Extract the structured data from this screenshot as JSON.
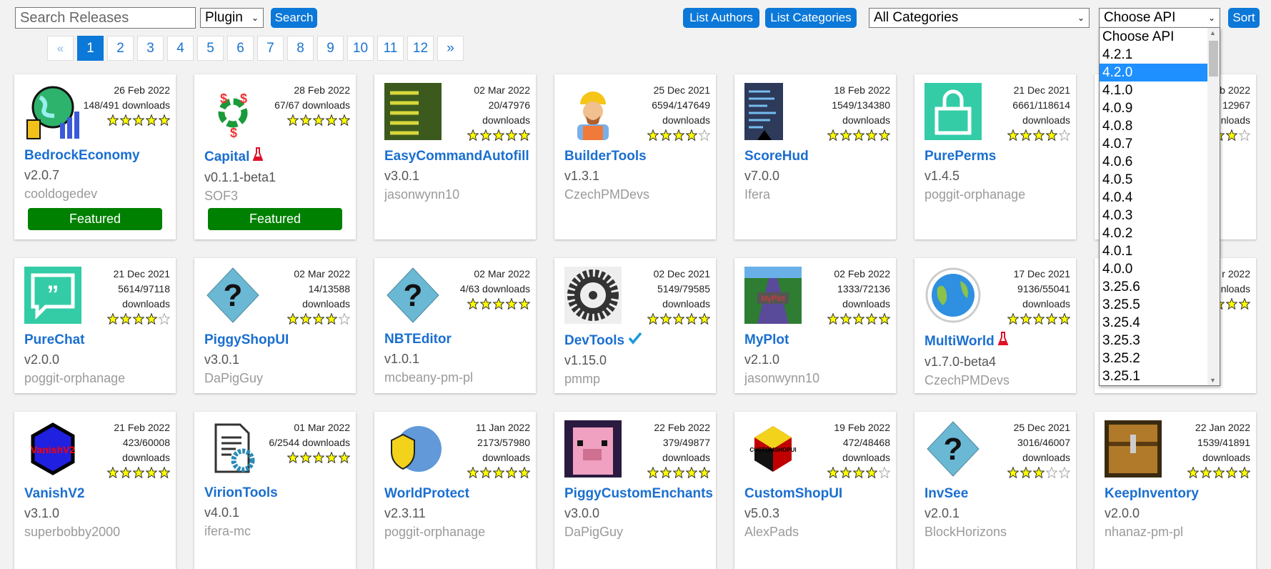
{
  "toolbar": {
    "search_placeholder": "Search Releases",
    "type_select": "Plugin",
    "search_label": "Search",
    "list_authors_label": "List Authors",
    "list_categories_label": "List Categories",
    "category_select": "All Categories",
    "api_select": "Choose API",
    "sort_label": "Sort"
  },
  "pagination": {
    "prev": "«",
    "next": "»",
    "pages": [
      "1",
      "2",
      "3",
      "4",
      "5",
      "6",
      "7",
      "8",
      "9",
      "10",
      "11",
      "12"
    ],
    "current": "1"
  },
  "api_dropdown": {
    "selected": "4.2.0",
    "options": [
      "Choose API",
      "4.2.1",
      "4.2.0",
      "4.1.0",
      "4.0.9",
      "4.0.8",
      "4.0.7",
      "4.0.6",
      "4.0.5",
      "4.0.4",
      "4.0.3",
      "4.0.2",
      "4.0.1",
      "4.0.0",
      "3.25.6",
      "3.25.5",
      "3.25.4",
      "3.25.3",
      "3.25.2",
      "3.25.1"
    ]
  },
  "featured_label": "Featured",
  "colors": {
    "accent": "#0c78d8",
    "featured": "#008000",
    "link": "#1a6fd0",
    "selected_option": "#1e90ff"
  },
  "plugins": [
    {
      "name": "BedrockEconomy",
      "version": "v2.0.7",
      "author": "cooldogedev",
      "date": "26 Feb 2022",
      "downloads": [
        "148/491 downloads"
      ],
      "rating": 5,
      "featured": true,
      "icon": "globe-coins-chart-icon",
      "icon_color": "#2db36b"
    },
    {
      "name": "Capital",
      "version": "v0.1.1-beta1",
      "author": "SOF3",
      "date": "28 Feb 2022",
      "downloads": [
        "67/67 downloads"
      ],
      "rating": 5,
      "featured": true,
      "badge": "flask",
      "icon": "recycle-dollar-icon",
      "icon_color": "#1a9a3a"
    },
    {
      "name": "EasyCommandAutofill",
      "version": "v3.0.1",
      "author": "jasonwynn10",
      "date": "02 Mar 2022",
      "downloads": [
        "20/47976 downloads"
      ],
      "rating": 5,
      "icon": "command-list-icon",
      "icon_color": "#3d5a1e"
    },
    {
      "name": "BuilderTools",
      "version": "v1.3.1",
      "author": "CzechPMDevs",
      "date": "25 Dec 2021",
      "downloads": [
        "6594/147649",
        "downloads"
      ],
      "rating": 4,
      "icon": "builder-avatar-icon",
      "icon_color": "#f5c518"
    },
    {
      "name": "ScoreHud",
      "version": "v7.0.0",
      "author": "Ifera",
      "date": "18 Feb 2022",
      "downloads": [
        "1549/134380",
        "downloads"
      ],
      "rating": 5,
      "icon": "scoreboard-icon",
      "icon_color": "#2d3a5a"
    },
    {
      "name": "PurePerms",
      "version": "v1.4.5",
      "author": "poggit-orphanage",
      "date": "21 Dec 2021",
      "downloads": [
        "6661/118614",
        "downloads"
      ],
      "rating": 4,
      "icon": "padlock-icon",
      "icon_color": "#33cca6"
    },
    {
      "name": "",
      "version": "",
      "author": "",
      "date": "b 2022",
      "downloads": [
        "12967",
        "nloads"
      ],
      "rating": 4,
      "icon": "",
      "icon_color": "#ffffff"
    },
    {
      "name": "PureChat",
      "version": "v2.0.0",
      "author": "poggit-orphanage",
      "date": "21 Dec 2021",
      "downloads": [
        "5614/97118",
        "downloads"
      ],
      "rating": 4,
      "icon": "chat-bubble-icon",
      "icon_color": "#33cca6"
    },
    {
      "name": "PiggyShopUI",
      "version": "v3.0.1",
      "author": "DaPigGuy",
      "date": "02 Mar 2022",
      "downloads": [
        "14/13588 downloads"
      ],
      "rating": 4,
      "icon": "question-diamond-icon",
      "icon_color": "#6bb8d4"
    },
    {
      "name": "NBTEditor",
      "version": "v1.0.1",
      "author": "mcbeany-pm-pl",
      "date": "02 Mar 2022",
      "downloads": [
        "4/63 downloads"
      ],
      "rating": 5,
      "icon": "question-diamond-icon",
      "icon_color": "#6bb8d4"
    },
    {
      "name": "DevTools",
      "version": "v1.15.0",
      "author": "pmmp",
      "date": "02 Dec 2021",
      "downloads": [
        "5149/79585",
        "downloads"
      ],
      "rating": 5,
      "badge": "check",
      "icon": "gear-icon",
      "icon_color": "#333333"
    },
    {
      "name": "MyPlot",
      "version": "v2.1.0",
      "author": "jasonwynn10",
      "date": "02 Feb 2022",
      "downloads": [
        "1333/72136",
        "downloads"
      ],
      "rating": 5,
      "icon": "plot-road-icon",
      "icon_color": "#2e7d32"
    },
    {
      "name": "MultiWorld",
      "version": "v1.7.0-beta4",
      "author": "CzechPMDevs",
      "date": "17 Dec 2021",
      "downloads": [
        "9136/55041",
        "downloads"
      ],
      "rating": 5,
      "badge": "flask",
      "icon": "earth-icon",
      "icon_color": "#2f8fe0"
    },
    {
      "name": "",
      "version": "",
      "author": "",
      "date": "r 2022",
      "downloads": [
        "nloads"
      ],
      "rating": 5,
      "icon": "",
      "icon_color": "#ffffff"
    },
    {
      "name": "VanishV2",
      "version": "v3.1.0",
      "author": "superbobby2000",
      "date": "21 Feb 2022",
      "downloads": [
        "423/60008",
        "downloads"
      ],
      "rating": 5,
      "icon": "blue-cube-icon",
      "icon_color": "#2020e0"
    },
    {
      "name": "VirionTools",
      "version": "v4.0.1",
      "author": "ifera-mc",
      "date": "01 Mar 2022",
      "downloads": [
        "6/2544 downloads"
      ],
      "rating": 5,
      "icon": "document-gear-icon",
      "icon_color": "#2a8ab8"
    },
    {
      "name": "WorldProtect",
      "version": "v2.3.11",
      "author": "poggit-orphanage",
      "date": "11 Jan 2022",
      "downloads": [
        "2173/57980",
        "downloads"
      ],
      "rating": 5,
      "icon": "globe-shield-icon",
      "icon_color": "#3a7fd0"
    },
    {
      "name": "PiggyCustomEnchants",
      "version": "v3.0.0",
      "author": "DaPigGuy",
      "date": "22 Feb 2022",
      "downloads": [
        "379/49877",
        "downloads"
      ],
      "rating": 5,
      "icon": "pig-icon",
      "icon_color": "#f0a0c0"
    },
    {
      "name": "CustomShopUI",
      "version": "v5.0.3",
      "author": "AlexPads",
      "date": "19 Feb 2022",
      "downloads": [
        "472/48468",
        "downloads"
      ],
      "rating": 4,
      "icon": "hexagon-logo-icon",
      "icon_color": "#c00000"
    },
    {
      "name": "InvSee",
      "version": "v2.0.1",
      "author": "BlockHorizons",
      "date": "25 Dec 2021",
      "downloads": [
        "3016/46007",
        "downloads"
      ],
      "rating": 3,
      "icon": "question-diamond-icon",
      "icon_color": "#6bb8d4"
    },
    {
      "name": "KeepInventory",
      "version": "v2.0.0",
      "author": "nhanaz-pm-pl",
      "date": "22 Jan 2022",
      "downloads": [
        "1539/41891",
        "downloads"
      ],
      "rating": 5,
      "icon": "chest-icon",
      "icon_color": "#b07a2a"
    }
  ]
}
